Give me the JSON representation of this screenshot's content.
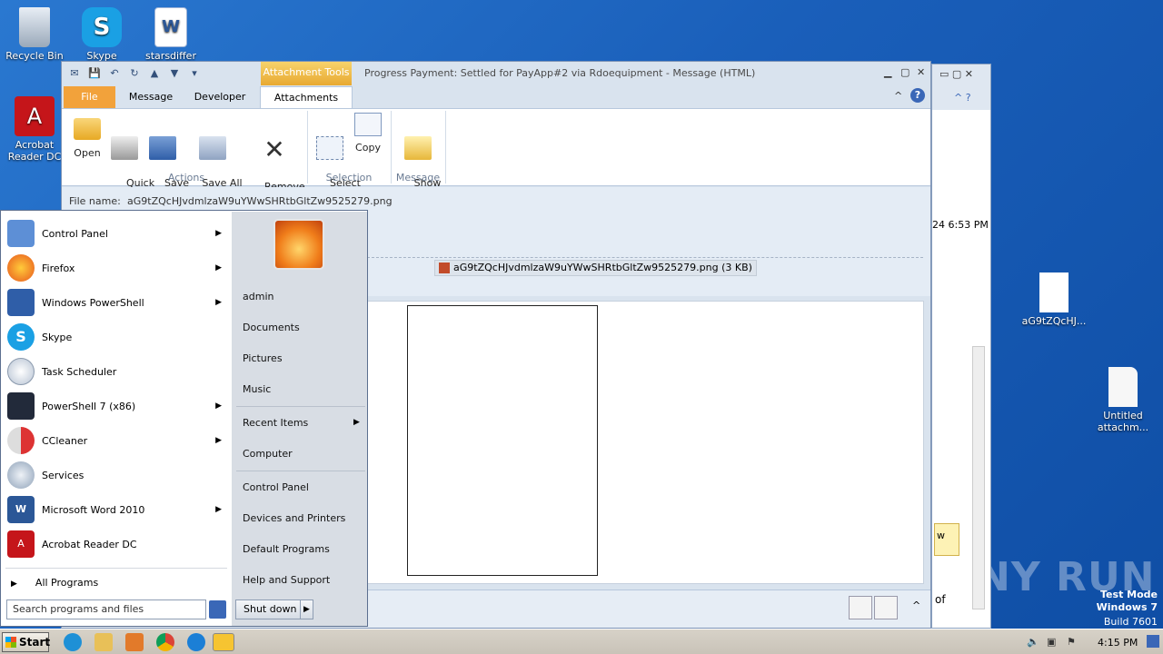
{
  "desktop": {
    "icons": [
      {
        "label": "Recycle Bin"
      },
      {
        "label": "Skype"
      },
      {
        "label": "starsdiffer"
      },
      {
        "label": "Acrobat Reader DC"
      },
      {
        "label": "aG9tZQcHJ..."
      },
      {
        "label": "Untitled attachm..."
      }
    ],
    "watermark": {
      "line1": "Test Mode",
      "line2": "Windows 7",
      "line3": "Build 7601"
    },
    "brand": "ANY RUN"
  },
  "back_window": {
    "time": "24 6:53 PM",
    "snippet1": "w",
    "snippet2": "of"
  },
  "outlook": {
    "context_tab": "Attachment Tools",
    "title": "Progress Payment: Settled for PayApp#2 via Rdoequipment  -  Message (HTML)",
    "tabs": [
      "File",
      "Message",
      "Developer",
      "Attachments"
    ],
    "ribbon": {
      "buttons": [
        {
          "label": "Open"
        },
        {
          "label": "Quick\nPrint"
        },
        {
          "label": "Save\nAs"
        },
        {
          "label": "Save All\nAttachments"
        },
        {
          "label": "Remove\nAttachment"
        },
        {
          "label": "Select\nAll"
        },
        {
          "label": "Copy"
        },
        {
          "label": "Show\nMessage"
        }
      ],
      "groups": [
        "Actions",
        "Selection",
        "Message"
      ]
    },
    "file_name_label": "File name:",
    "file_name_value": "aG9tZQcHJvdmlzaW9uYWwSHRtbGltZw9525279.png",
    "attachment_chip": "aG9tZQcHJvdmlzaW9uYWwSHRtbGltZw9525279.png (3 KB)"
  },
  "start_menu": {
    "programs": [
      {
        "label": "Control Panel",
        "arrow": true
      },
      {
        "label": "Firefox",
        "arrow": true
      },
      {
        "label": "Windows PowerShell",
        "arrow": true
      },
      {
        "label": "Skype",
        "arrow": false
      },
      {
        "label": "Task Scheduler",
        "arrow": false
      },
      {
        "label": "PowerShell 7 (x86)",
        "arrow": true
      },
      {
        "label": "CCleaner",
        "arrow": true
      },
      {
        "label": "Services",
        "arrow": false
      },
      {
        "label": "Microsoft Word 2010",
        "arrow": true
      },
      {
        "label": "Acrobat Reader DC",
        "arrow": false
      }
    ],
    "all_programs": "All Programs",
    "search_placeholder": "Search programs and files",
    "right_links": [
      "admin",
      "Documents",
      "Pictures",
      "Music",
      "Recent Items",
      "Computer",
      "Control Panel",
      "Devices and Printers",
      "Default Programs",
      "Help and Support"
    ],
    "shutdown": "Shut down"
  },
  "taskbar": {
    "start": "Start",
    "time": "4:15 PM"
  },
  "colors": {
    "accent_file": "#f2a23b",
    "context_tab": "#e8a932",
    "desktop": "#1d63b8"
  }
}
